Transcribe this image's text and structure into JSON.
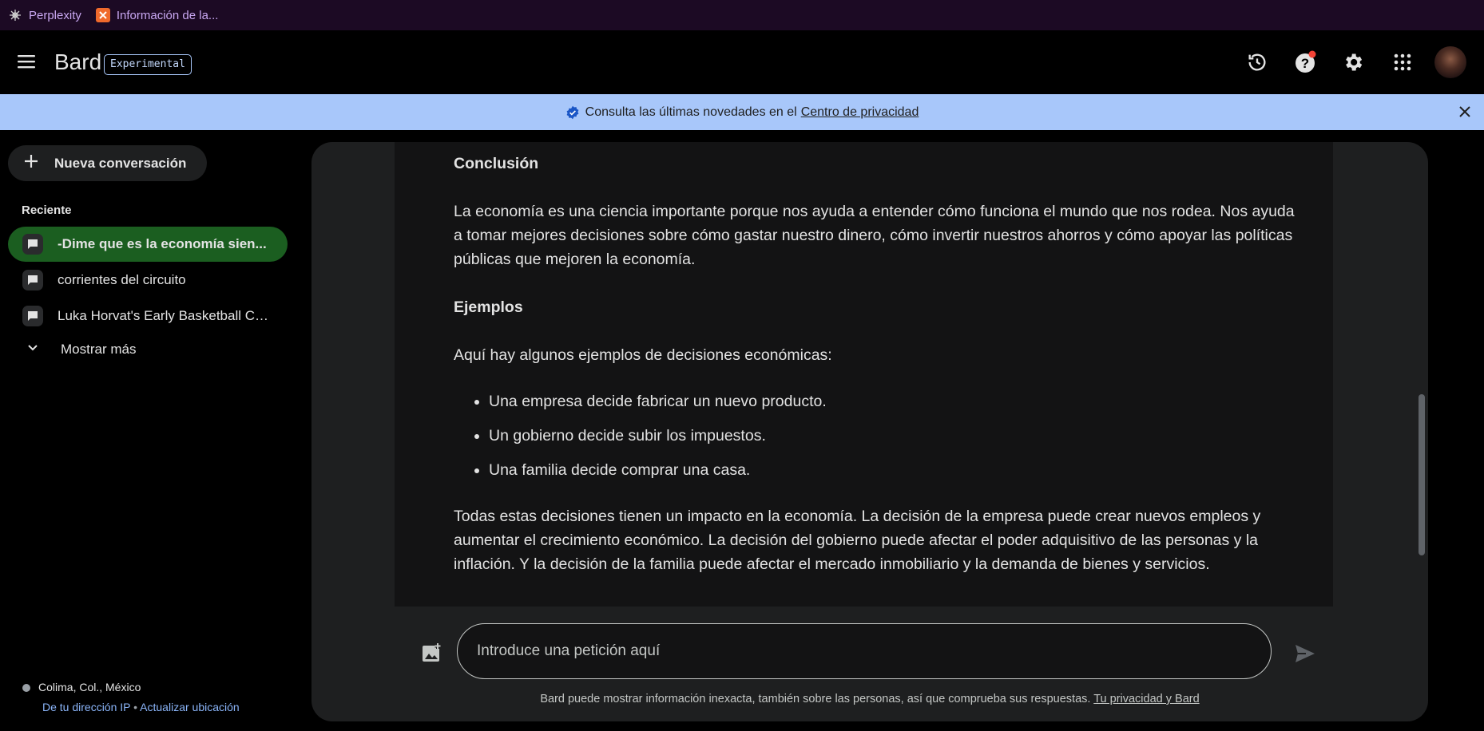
{
  "bookmarks": [
    {
      "label": "Perplexity",
      "icon": "perplexity-icon"
    },
    {
      "label": "Información de la...",
      "icon": "xampp-icon"
    }
  ],
  "header": {
    "brand": "Bard",
    "badge": "Experimental",
    "icons": [
      "history-icon",
      "help-icon",
      "settings-icon",
      "apps-icon"
    ],
    "accent_color": "#a8c7fa"
  },
  "banner": {
    "text": "Consulta las últimas novedades en el",
    "link": "Centro de privacidad"
  },
  "sidebar": {
    "new_chat": "Nueva conversación",
    "recent_label": "Reciente",
    "items": [
      {
        "label": "-Dime que es la economía sien..."
      },
      {
        "label": "corrientes del circuito"
      },
      {
        "label": "Luka Horvat's Early Basketball Ca..."
      }
    ],
    "show_more": "Mostrar más",
    "active_color": "#1b5e20",
    "location": "Colima, Col., México",
    "location_source": "De tu dirección IP",
    "separator": "•",
    "update_location": "Actualizar ubicación"
  },
  "response": {
    "heading1": "Conclusión",
    "paragraph1": "La economía es una ciencia importante porque nos ayuda a entender cómo funciona el mundo que nos rodea. Nos ayuda a tomar mejores decisiones sobre cómo gastar nuestro dinero, cómo invertir nuestros ahorros y cómo apoyar las políticas públicas que mejoren la economía.",
    "heading2": "Ejemplos",
    "paragraph2": "Aquí hay algunos ejemplos de decisiones económicas:",
    "bullets": [
      "Una empresa decide fabricar un nuevo producto.",
      "Un gobierno decide subir los impuestos.",
      "Una familia decide comprar una casa."
    ],
    "paragraph3": "Todas estas decisiones tienen un impacto en la economía. La decisión de la empresa puede crear nuevos empleos y aumentar el crecimiento económico. La decisión del gobierno puede afectar el poder adquisitivo de las personas y la inflación. Y la decisión de la familia puede afectar el mercado inmobiliario y la demanda de bienes y servicios."
  },
  "input": {
    "placeholder": "Introduce una petición aquí",
    "value": ""
  },
  "footer": {
    "disclaimer": "Bard puede mostrar información inexacta, también sobre las personas, así que comprueba sus respuestas.",
    "link": "Tu privacidad y Bard"
  }
}
